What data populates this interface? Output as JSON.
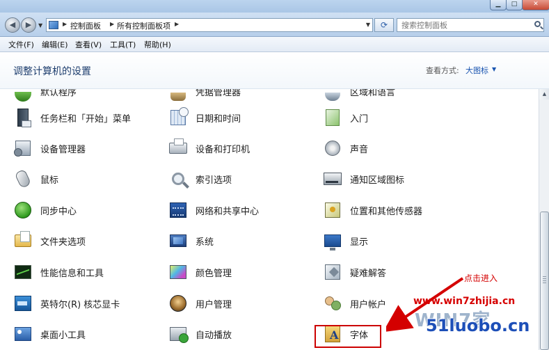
{
  "address": {
    "crumbs": [
      "控制面板",
      "所有控制面板项"
    ],
    "search_placeholder": "搜索控制面板"
  },
  "menu": [
    "文件(F)",
    "编辑(E)",
    "查看(V)",
    "工具(T)",
    "帮助(H)"
  ],
  "header": {
    "title": "调整计算机的设置",
    "view_by_label": "查看方式:",
    "view_by_value": "大图标"
  },
  "items": {
    "col1": [
      "默认程序",
      "任务栏和「开始」菜单",
      "设备管理器",
      "鼠标",
      "同步中心",
      "文件夹选项",
      "性能信息和工具",
      "英特尔(R) 核芯显卡",
      "桌面小工具"
    ],
    "col2": [
      "凭据管理器",
      "日期和时间",
      "设备和打印机",
      "索引选项",
      "网络和共享中心",
      "系统",
      "颜色管理",
      "用户管理",
      "自动播放"
    ],
    "col3": [
      "区域和语言",
      "入门",
      "声音",
      "通知区域图标",
      "位置和其他传感器",
      "显示",
      "疑难解答",
      "用户帐户",
      "字体"
    ]
  },
  "highlighted_item": "字体",
  "annotation": {
    "text": "点击进入",
    "color": "#d40000"
  },
  "watermarks": {
    "url": "www.win7zhijia.cn",
    "logo": "WIN7家",
    "site": "51luobo.cn"
  },
  "icons": {
    "col1": [
      "default-programs-icon",
      "taskbar-icon",
      "device-manager-icon",
      "mouse-icon",
      "sync-center-icon",
      "folder-options-icon",
      "performance-icon",
      "intel-graphics-icon",
      "desktop-gadgets-icon"
    ],
    "col2": [
      "credential-manager-icon",
      "date-time-icon",
      "devices-printers-icon",
      "indexing-options-icon",
      "network-sharing-icon",
      "system-icon",
      "color-management-icon",
      "user-management-icon",
      "autoplay-icon"
    ],
    "col3": [
      "region-language-icon",
      "getting-started-icon",
      "sound-icon",
      "notification-area-icon",
      "location-sensors-icon",
      "display-icon",
      "troubleshooting-icon",
      "user-accounts-icon",
      "fonts-icon"
    ]
  }
}
